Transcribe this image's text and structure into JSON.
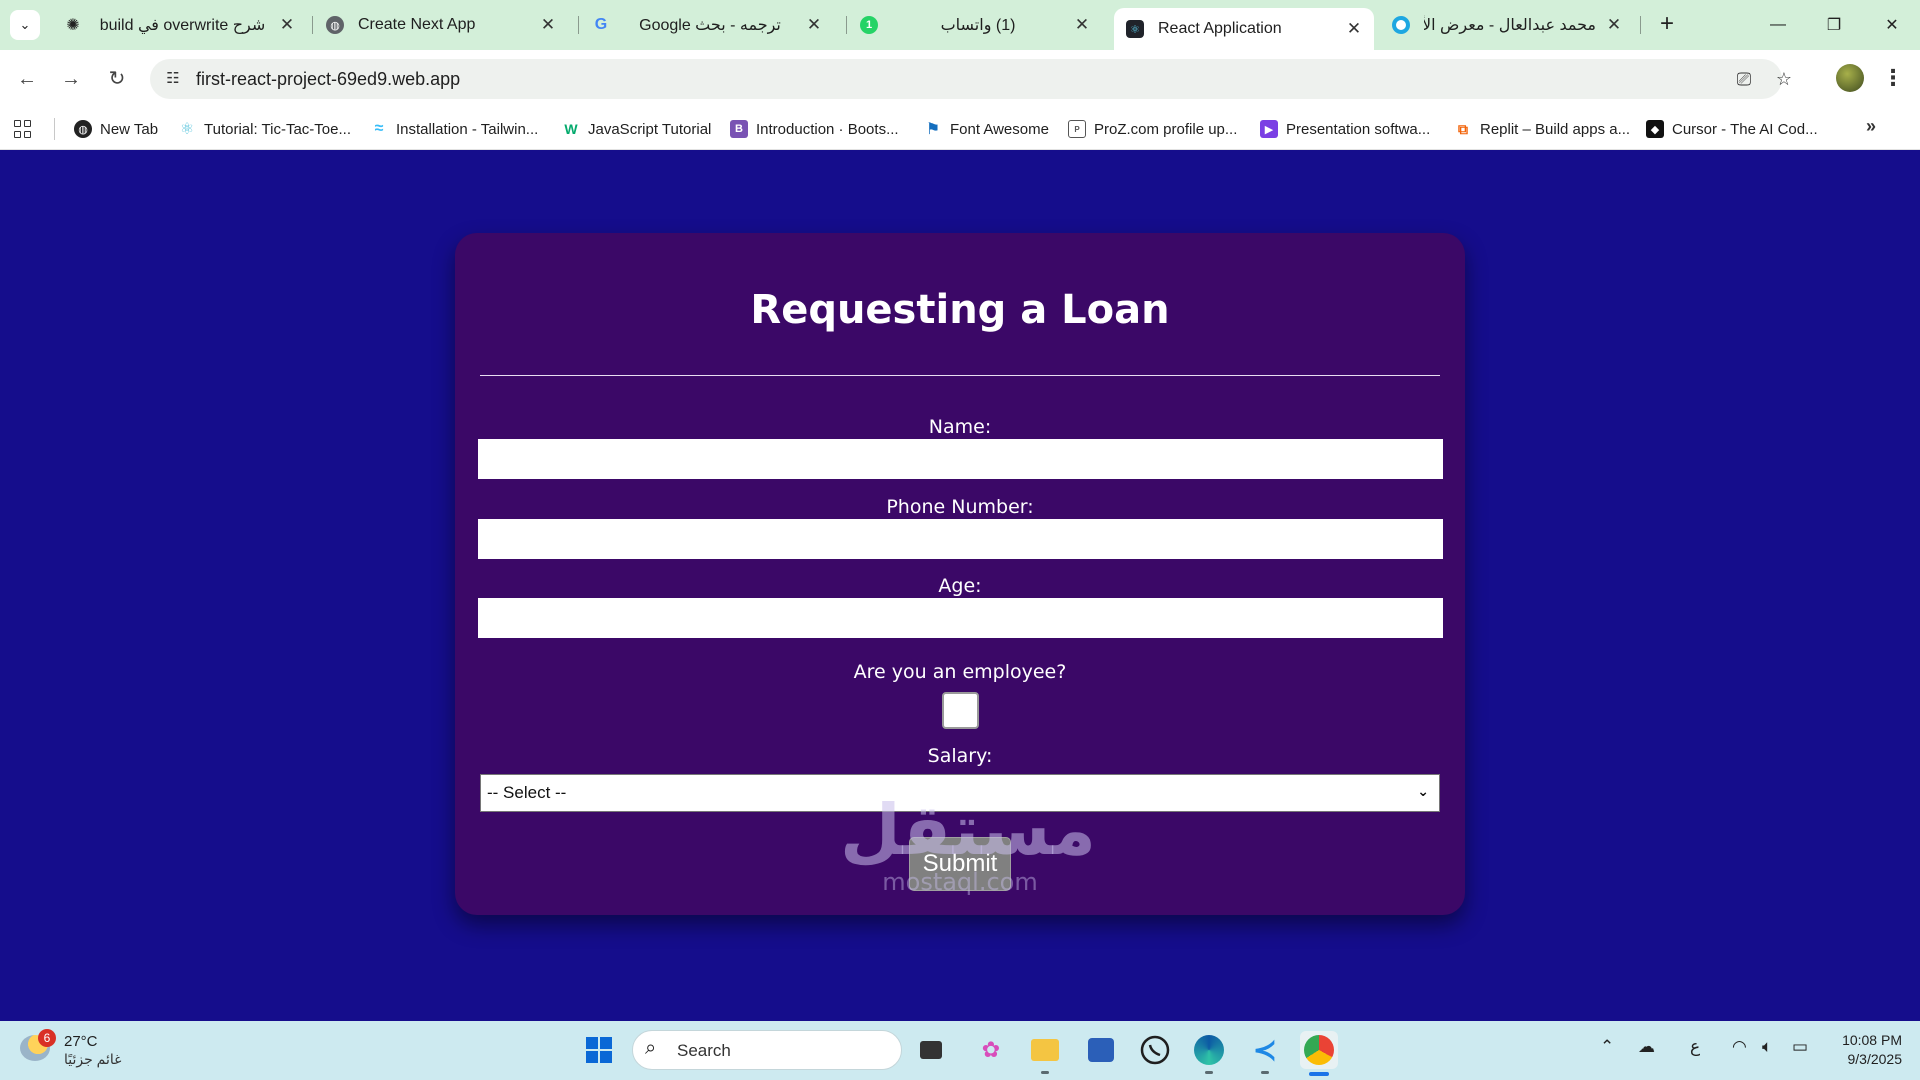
{
  "browser": {
    "tabs": [
      {
        "title": "شرح overwrite في build",
        "active": false
      },
      {
        "title": "Create Next App",
        "active": false
      },
      {
        "title": "ترجمه - بحث Google",
        "active": false
      },
      {
        "title": "(1) واتساب",
        "active": false
      },
      {
        "title": "React Application",
        "active": true
      },
      {
        "title": "محمد عبدالعال - معرض الأعمال",
        "active": false
      }
    ],
    "whatsapp_badge": "1",
    "address": "first-react-project-69ed9.web.app",
    "bookmarks": [
      {
        "label": "New Tab",
        "icon": "globe-icon"
      },
      {
        "label": "Tutorial: Tic-Tac-Toe...",
        "icon": "react-icon"
      },
      {
        "label": "Installation - Tailwin...",
        "icon": "tailwind-icon"
      },
      {
        "label": "JavaScript Tutorial",
        "icon": "w3schools-icon"
      },
      {
        "label": "Introduction · Boots...",
        "icon": "bootstrap-icon"
      },
      {
        "label": "Font Awesome",
        "icon": "flag-icon"
      },
      {
        "label": "ProZ.com profile up...",
        "icon": "proz-icon"
      },
      {
        "label": "Presentation softwa...",
        "icon": "presentation-icon"
      },
      {
        "label": "Replit – Build apps a...",
        "icon": "replit-icon"
      },
      {
        "label": "Cursor - The AI Cod...",
        "icon": "cursor-icon"
      }
    ]
  },
  "form": {
    "title": "Requesting a Loan",
    "name_label": "Name:",
    "name_value": "",
    "phone_label": "Phone Number:",
    "phone_value": "",
    "age_label": "Age:",
    "age_value": "",
    "employee_label": "Are you an employee?",
    "employee_checked": false,
    "salary_label": "Salary:",
    "salary_selected": "-- Select --",
    "submit_label": "Submit"
  },
  "watermark": {
    "text": "مستقل",
    "sub": "mostaql.com"
  },
  "taskbar": {
    "weather_temp": "27°C",
    "weather_condition": "غائم جزئيًا",
    "weather_badge": "6",
    "search_label": "Search",
    "language": "ع",
    "time": "10:08 PM",
    "date": "9/3/2025"
  },
  "colors": {
    "page_background": "#150d8c",
    "card_background": "#3b0867",
    "submit_background": "#808080",
    "tabstrip": "#d3efd9",
    "taskbar": "#cdeaf0"
  }
}
